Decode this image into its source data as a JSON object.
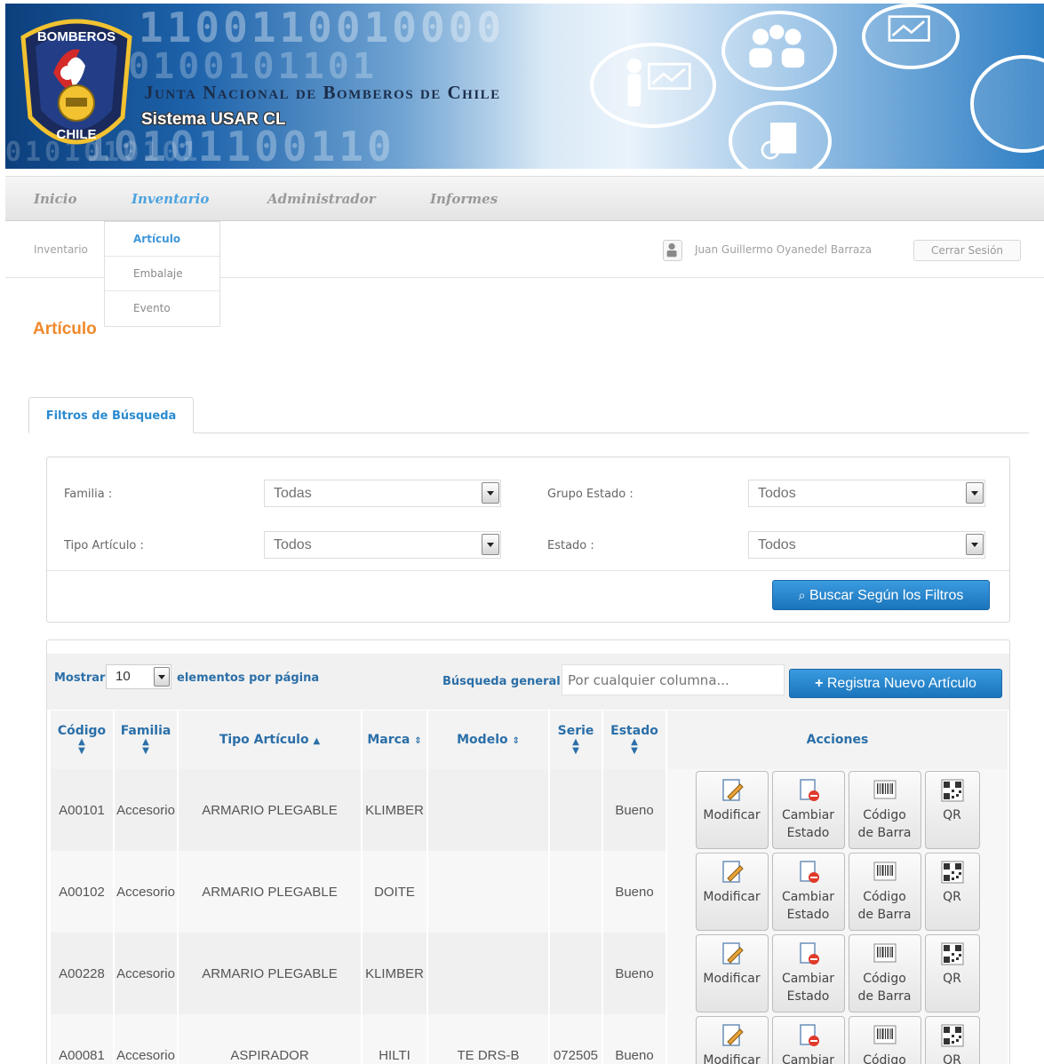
{
  "header": {
    "org_title": "Junta Nacional de Bomberos de Chile",
    "system_title": "Sistema USAR CL",
    "crest_text_top": "BOMBEROS",
    "crest_text_bottom": "CHILE"
  },
  "nav": {
    "items": [
      "Inicio",
      "Inventario",
      "Administrador",
      "Informes"
    ],
    "active": "Inventario",
    "dropdown": [
      "Artículo",
      "Embalaje",
      "Evento"
    ]
  },
  "breadcrumb": "Inventario",
  "user": {
    "name": "Juan Guillermo Oyanedel Barraza",
    "logout_label": "Cerrar Sesión"
  },
  "page_title": "Artículo",
  "filters": {
    "tab_label": "Filtros de Búsqueda",
    "familia": {
      "label": "Familia :",
      "value": "Todas"
    },
    "grupo_estado": {
      "label": "Grupo Estado :",
      "value": "Todos"
    },
    "tipo_articulo": {
      "label": "Tipo Artículo :",
      "value": "Todos"
    },
    "estado": {
      "label": "Estado :",
      "value": "Todos"
    },
    "search_button": "Buscar Según los Filtros"
  },
  "table_controls": {
    "show_label": "Mostrar",
    "page_size": "10",
    "per_page_label": "elementos por página",
    "search_label": "Búsqueda general:",
    "search_placeholder": "Por cualquier columna...",
    "new_button": "Registra Nuevo Artículo"
  },
  "table": {
    "columns": [
      "Código",
      "Familia",
      "Tipo Artículo",
      "Marca",
      "Modelo",
      "Serie",
      "Estado",
      "Acciones"
    ],
    "rows": [
      [
        "A00101",
        "Accesorio",
        "ARMARIO PLEGABLE",
        "KLIMBER",
        "",
        "",
        "Bueno"
      ],
      [
        "A00102",
        "Accesorio",
        "ARMARIO PLEGABLE",
        "DOITE",
        "",
        "",
        "Bueno"
      ],
      [
        "A00228",
        "Accesorio",
        "ARMARIO PLEGABLE",
        "KLIMBER",
        "",
        "",
        "Bueno"
      ],
      [
        "A00081",
        "Accesorio",
        "ASPIRADOR",
        "HILTI",
        "TE DRS-B",
        "072505",
        "Bueno"
      ]
    ],
    "actions": {
      "modify": "Modificar",
      "change_state_1": "Cambiar",
      "change_state_2": "Estado",
      "barcode_1": "Código",
      "barcode_2": "de Barra",
      "qr": "QR"
    }
  },
  "colors": {
    "accent_orange": "#f0892b",
    "link_blue": "#2b6fa8",
    "button_blue": "#1b74bb"
  }
}
